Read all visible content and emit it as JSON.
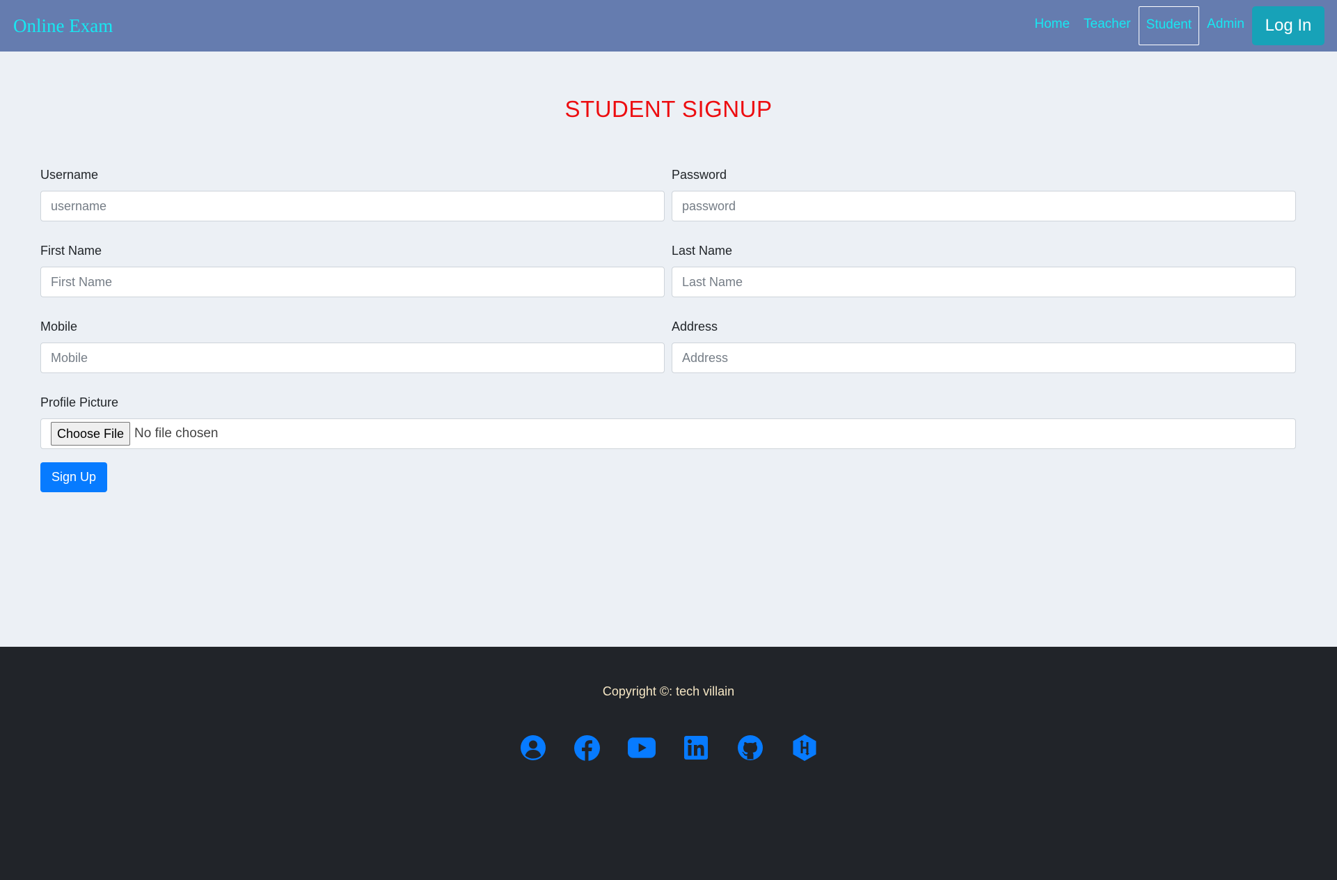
{
  "navbar": {
    "brand": "Online Exam",
    "links": [
      "Home",
      "Teacher",
      "Student",
      "Admin"
    ],
    "active_link": "Student",
    "login_label": "Log In"
  },
  "page_title": "STUDENT SIGNUP",
  "form": {
    "username": {
      "label": "Username",
      "placeholder": "username"
    },
    "password": {
      "label": "Password",
      "placeholder": "password"
    },
    "first_name": {
      "label": "First Name",
      "placeholder": "First Name"
    },
    "last_name": {
      "label": "Last Name",
      "placeholder": "Last Name"
    },
    "mobile": {
      "label": "Mobile",
      "placeholder": "Mobile"
    },
    "address": {
      "label": "Address",
      "placeholder": "Address"
    },
    "profile_picture": {
      "label": "Profile Picture",
      "button": "Choose File",
      "status": "No file chosen"
    },
    "submit_label": "Sign Up"
  },
  "footer": {
    "copyright": "Copyright ©: tech villain",
    "icons": [
      "user-circle-icon",
      "facebook-icon",
      "youtube-icon",
      "linkedin-icon",
      "github-icon",
      "hackerrank-icon"
    ]
  },
  "colors": {
    "navbar_bg": "#657caf",
    "nav_text": "#17e8f2",
    "login_button": "#17a2b8",
    "title_red": "#ed0d10",
    "primary_blue": "#077bff",
    "footer_bg": "#212429"
  }
}
